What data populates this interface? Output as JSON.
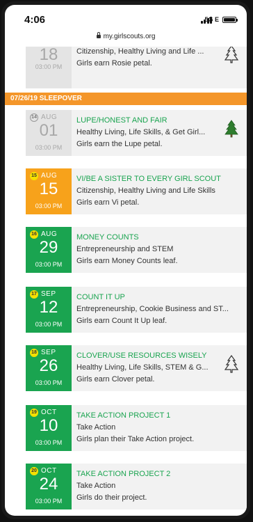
{
  "status_bar": {
    "time": "4:06",
    "network": "5G E"
  },
  "url_bar": {
    "url": "my.girlscouts.org"
  },
  "section": {
    "label": "07/26/19 SLEEPOVER"
  },
  "top_partial": {
    "day": "18",
    "time": "03:00 PM",
    "line1": "Citizenship, Healthy Living and Life ...",
    "line2": "Girls earn Rosie petal.",
    "icon": "tree-outline-icon"
  },
  "events": [
    {
      "num": "14",
      "month": "AUG",
      "day": "01",
      "time": "03:00 PM",
      "title": "LUPE/HONEST AND FAIR",
      "line1": "Healthy Living, Life Skills, & Get Girl...",
      "line2": "Girls earn the Lupe petal.",
      "color": "#e4e4e4",
      "style": "gray",
      "icon": "tree-filled-icon"
    },
    {
      "num": "15",
      "month": "AUG",
      "day": "15",
      "time": "03:00 PM",
      "title": "VI/BE A SISTER TO EVERY GIRL SCOUT",
      "line1": "Citizenship, Healthy Living and Life Skills",
      "line2": "Girls earn Vi petal.",
      "color": "#f7a21b",
      "style": "orange",
      "icon": ""
    },
    {
      "num": "16",
      "month": "AUG",
      "day": "29",
      "time": "03:00 PM",
      "title": "MONEY COUNTS",
      "line1": "Entrepreneurship and STEM",
      "line2": "Girls earn Money Counts leaf.",
      "color": "#1aa450",
      "style": "green",
      "icon": ""
    },
    {
      "num": "17",
      "month": "SEP",
      "day": "12",
      "time": "03:00 PM",
      "title": "COUNT IT UP",
      "line1": "Entrepreneurship, Cookie Business and ST...",
      "line2": "Girls earn Count It Up leaf.",
      "color": "#1aa450",
      "style": "green",
      "icon": ""
    },
    {
      "num": "18",
      "month": "SEP",
      "day": "26",
      "time": "03:00 PM",
      "title": "CLOVER/USE RESOURCES WISELY",
      "line1": "Healthy Living, Life Skills, STEM & G...",
      "line2": "Girls earn Clover petal.",
      "color": "#1aa450",
      "style": "green",
      "icon": "tree-outline-icon"
    },
    {
      "num": "19",
      "month": "OCT",
      "day": "10",
      "time": "03:00 PM",
      "title": "TAKE ACTION PROJECT 1",
      "line1": "Take Action",
      "line2": "Girls plan their Take Action project.",
      "color": "#1aa450",
      "style": "green",
      "icon": ""
    },
    {
      "num": "20",
      "month": "OCT",
      "day": "24",
      "time": "03:00 PM",
      "title": "TAKE ACTION PROJECT 2",
      "line1": "Take Action",
      "line2": "Girls do their project.",
      "color": "#1aa450",
      "style": "green",
      "icon": ""
    }
  ]
}
